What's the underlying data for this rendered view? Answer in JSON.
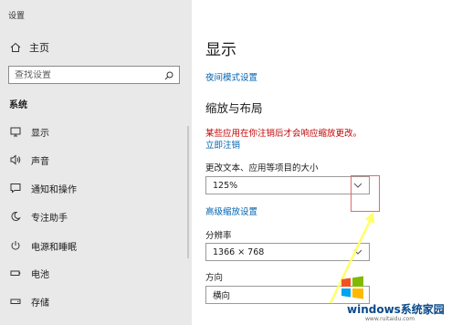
{
  "window": {
    "title": "设置"
  },
  "sidebar": {
    "home_label": "主页",
    "search_placeholder": "查找设置",
    "section_label": "系统",
    "items": [
      {
        "label": "显示",
        "icon": "monitor-icon"
      },
      {
        "label": "声音",
        "icon": "speaker-icon"
      },
      {
        "label": "通知和操作",
        "icon": "notification-icon"
      },
      {
        "label": "专注助手",
        "icon": "moon-icon"
      },
      {
        "label": "电源和睡眠",
        "icon": "power-icon"
      },
      {
        "label": "电池",
        "icon": "battery-icon"
      },
      {
        "label": "存储",
        "icon": "storage-icon"
      }
    ]
  },
  "main": {
    "title": "显示",
    "night_mode_link": "夜间模式设置",
    "scale_heading": "缩放与布局",
    "warning_text": "某些应用在你注销后才会响应缩放更改。",
    "signout_link": "立即注销",
    "size_label": "更改文本、应用等项目的大小",
    "size_value": "125%",
    "advanced_link": "高级缩放设置",
    "resolution_label": "分辨率",
    "resolution_value": "1366 × 768",
    "orientation_label": "方向",
    "orientation_value": "横向"
  },
  "overlay": {
    "watermark_text": "windows系统家园",
    "watermark_url": "www.ruitaidu.com",
    "highlight_color": "#e26a6a",
    "arrow_color": "#ffff66"
  }
}
